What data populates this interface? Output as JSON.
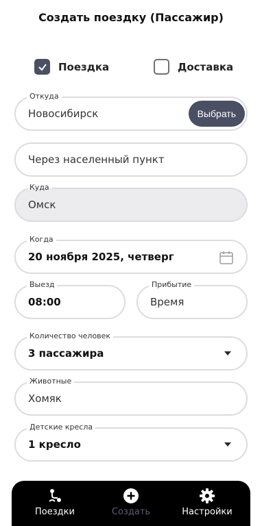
{
  "header": {
    "title": "Создать поездку (Пассажир)"
  },
  "trip_type": {
    "trip_label": "Поездка",
    "trip_checked": true,
    "delivery_label": "Доставка",
    "delivery_checked": false
  },
  "form": {
    "from": {
      "label": "Откуда",
      "value": "Новосибирск",
      "button": "Выбрать"
    },
    "via": {
      "placeholder": "Через населенный пункт"
    },
    "to": {
      "label": "Куда",
      "value": "Омск"
    },
    "when": {
      "label": "Когда",
      "value": "20 ноября 2025, четверг"
    },
    "departure": {
      "label": "Выезд",
      "value": "08:00"
    },
    "arrival": {
      "label": "Прибытие",
      "placeholder": "Время"
    },
    "people": {
      "label": "Количество человек",
      "value": "3 пассажира"
    },
    "pets": {
      "label": "Животные",
      "value": "Хомяк"
    },
    "child_seats": {
      "label": "Детские кресла",
      "value": "1 кресло"
    }
  },
  "nav": {
    "items": [
      {
        "label": "Поездки",
        "icon": "route-icon",
        "active": false
      },
      {
        "label": "Создать",
        "icon": "plus-circle-icon",
        "active": true
      },
      {
        "label": "Настройки",
        "icon": "gear-icon",
        "active": false
      }
    ]
  },
  "colors": {
    "accent": "#4b4f63",
    "nav_bg": "#000000",
    "field_border": "#dcdce0",
    "grey_field": "#ececef"
  }
}
